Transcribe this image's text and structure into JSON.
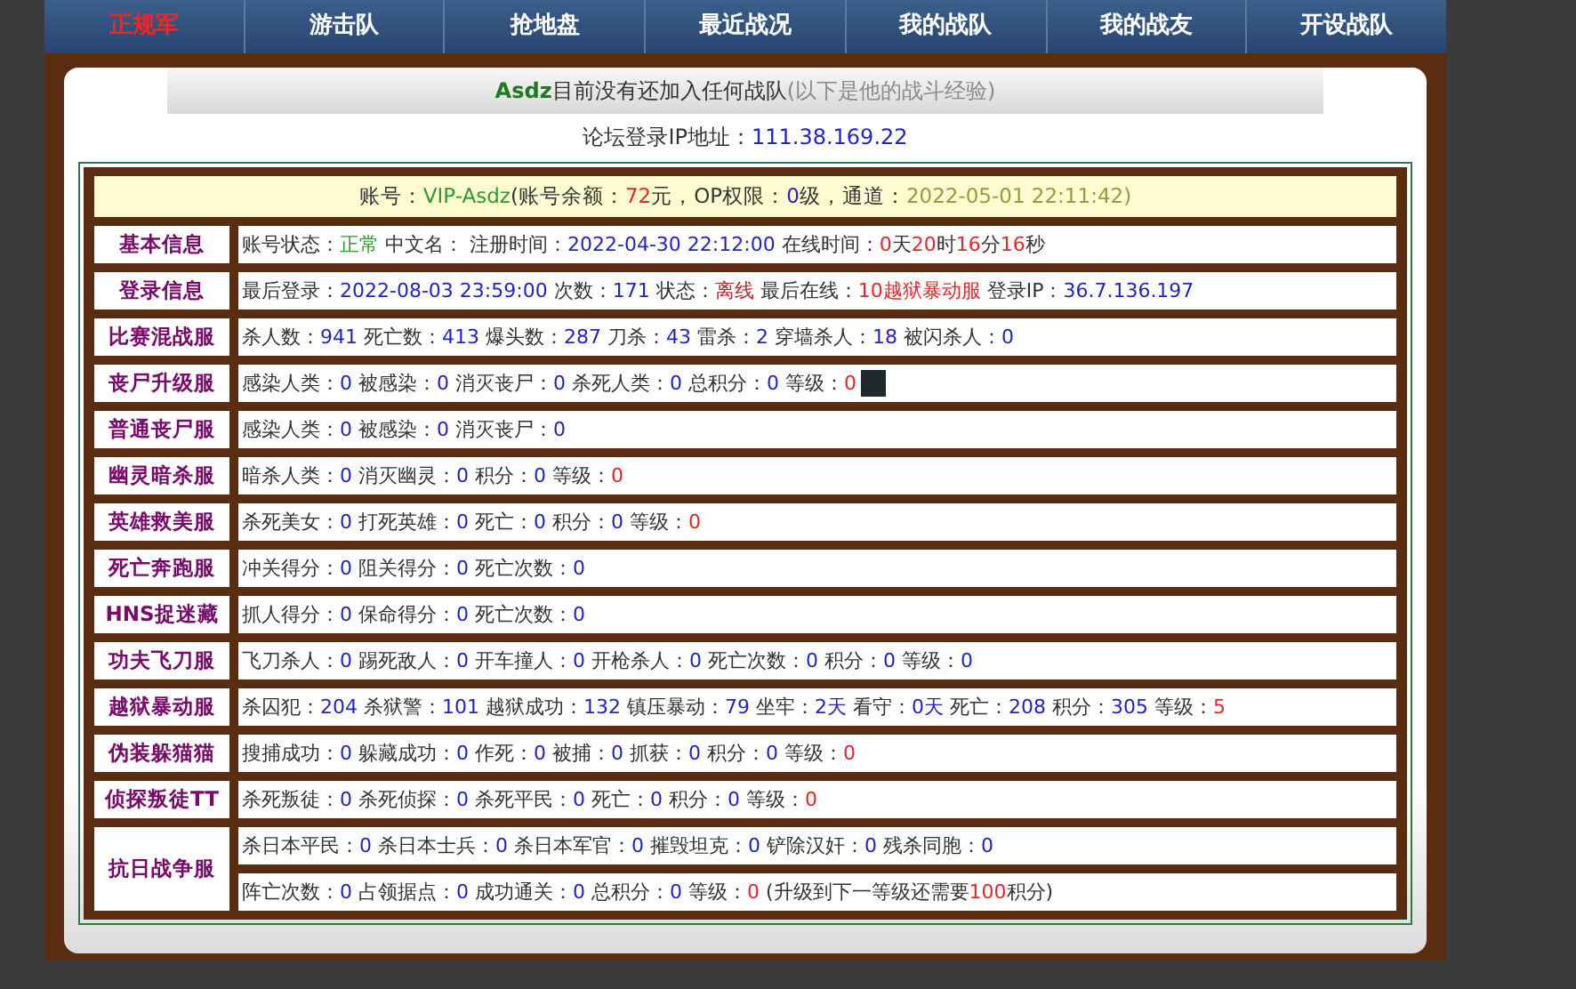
{
  "nav": [
    {
      "label": "正规军",
      "selected": true
    },
    {
      "label": "游击队",
      "selected": false
    },
    {
      "label": "抢地盘",
      "selected": false
    },
    {
      "label": "最近战况",
      "selected": false
    },
    {
      "label": "我的战队",
      "selected": false
    },
    {
      "label": "我的战友",
      "selected": false
    },
    {
      "label": "开设战队",
      "selected": false
    }
  ],
  "heading": [
    {
      "text": "Asdz",
      "kind": "name"
    },
    {
      "text": "目前没有还加入任何战队",
      "kind": "label"
    },
    {
      "text": "(以下是他的战斗经验)",
      "kind": "note"
    }
  ],
  "ip_line": [
    {
      "text": "论坛登录IP地址：",
      "kind": "label"
    },
    {
      "text": "111.38.169.22",
      "kind": "value"
    }
  ],
  "account_line": [
    {
      "text": "账号：",
      "kind": "label"
    },
    {
      "text": "VIP-Asdz",
      "kind": "ok"
    },
    {
      "text": "(账号余额：",
      "kind": "label"
    },
    {
      "text": "72",
      "kind": "alert"
    },
    {
      "text": "元，OP权限：",
      "kind": "label"
    },
    {
      "text": "0",
      "kind": "value"
    },
    {
      "text": "级，通道：",
      "kind": "label"
    },
    {
      "text": "2022-05-01 22:11:42",
      "kind": "date"
    },
    {
      "text": ")",
      "kind": "date"
    }
  ],
  "rows": [
    {
      "category": "基本信息",
      "lines": [
        [
          {
            "text": "账号状态：",
            "kind": "label"
          },
          {
            "text": "正常",
            "kind": "ok"
          },
          {
            "text": " 中文名： 注册时间：",
            "kind": "label"
          },
          {
            "text": "2022-04-30 22:12:00",
            "kind": "value"
          },
          {
            "text": " 在线时间：",
            "kind": "label"
          },
          {
            "text": "0",
            "kind": "alert"
          },
          {
            "text": "天",
            "kind": "label"
          },
          {
            "text": "20",
            "kind": "alert"
          },
          {
            "text": "时",
            "kind": "label"
          },
          {
            "text": "16",
            "kind": "alert"
          },
          {
            "text": "分",
            "kind": "label"
          },
          {
            "text": "16",
            "kind": "alert"
          },
          {
            "text": "秒",
            "kind": "label"
          }
        ]
      ]
    },
    {
      "category": "登录信息",
      "lines": [
        [
          {
            "text": "最后登录：",
            "kind": "label"
          },
          {
            "text": "2022-08-03 23:59:00",
            "kind": "value"
          },
          {
            "text": " 次数：",
            "kind": "label"
          },
          {
            "text": "171",
            "kind": "value"
          },
          {
            "text": " 状态：",
            "kind": "label"
          },
          {
            "text": "离线",
            "kind": "offline"
          },
          {
            "text": " 最后在线：",
            "kind": "label"
          },
          {
            "text": "10越狱暴动服",
            "kind": "alert"
          },
          {
            "text": " 登录IP：",
            "kind": "label"
          },
          {
            "text": "36.7.136.197",
            "kind": "value"
          }
        ]
      ]
    },
    {
      "category": "比赛混战服",
      "lines": [
        [
          {
            "text": "杀人数：",
            "kind": "label"
          },
          {
            "text": "941",
            "kind": "value"
          },
          {
            "text": " 死亡数：",
            "kind": "label"
          },
          {
            "text": "413",
            "kind": "value"
          },
          {
            "text": " 爆头数：",
            "kind": "label"
          },
          {
            "text": "287",
            "kind": "value"
          },
          {
            "text": " 刀杀：",
            "kind": "label"
          },
          {
            "text": "43",
            "kind": "value"
          },
          {
            "text": " 雷杀：",
            "kind": "label"
          },
          {
            "text": "2",
            "kind": "value"
          },
          {
            "text": " 穿墙杀人：",
            "kind": "label"
          },
          {
            "text": "18",
            "kind": "value"
          },
          {
            "text": " 被闪杀人：",
            "kind": "label"
          },
          {
            "text": "0",
            "kind": "value"
          }
        ]
      ]
    },
    {
      "category": "丧尸升级服",
      "lines": [
        [
          {
            "text": "感染人类：",
            "kind": "label"
          },
          {
            "text": "0",
            "kind": "value"
          },
          {
            "text": " 被感染：",
            "kind": "label"
          },
          {
            "text": "0",
            "kind": "value"
          },
          {
            "text": " 消灭丧尸：",
            "kind": "label"
          },
          {
            "text": "0",
            "kind": "value"
          },
          {
            "text": " 杀死人类：",
            "kind": "label"
          },
          {
            "text": "0",
            "kind": "value"
          },
          {
            "text": " 总积分：",
            "kind": "label"
          },
          {
            "text": "0",
            "kind": "value"
          },
          {
            "text": " 等级：",
            "kind": "label"
          },
          {
            "text": "0",
            "kind": "alert"
          },
          {
            "kind": "image"
          }
        ]
      ]
    },
    {
      "category": "普通丧尸服",
      "lines": [
        [
          {
            "text": "感染人类：",
            "kind": "label"
          },
          {
            "text": "0",
            "kind": "value"
          },
          {
            "text": " 被感染：",
            "kind": "label"
          },
          {
            "text": "0",
            "kind": "value"
          },
          {
            "text": " 消灭丧尸：",
            "kind": "label"
          },
          {
            "text": "0",
            "kind": "value"
          }
        ]
      ]
    },
    {
      "category": "幽灵暗杀服",
      "lines": [
        [
          {
            "text": "暗杀人类：",
            "kind": "label"
          },
          {
            "text": "0",
            "kind": "value"
          },
          {
            "text": " 消灭幽灵：",
            "kind": "label"
          },
          {
            "text": "0",
            "kind": "value"
          },
          {
            "text": " 积分：",
            "kind": "label"
          },
          {
            "text": "0",
            "kind": "value"
          },
          {
            "text": " 等级：",
            "kind": "label"
          },
          {
            "text": "0",
            "kind": "alert"
          }
        ]
      ]
    },
    {
      "category": "英雄救美服",
      "lines": [
        [
          {
            "text": "杀死美女：",
            "kind": "label"
          },
          {
            "text": "0",
            "kind": "value"
          },
          {
            "text": " 打死英雄：",
            "kind": "label"
          },
          {
            "text": "0",
            "kind": "value"
          },
          {
            "text": " 死亡：",
            "kind": "label"
          },
          {
            "text": "0",
            "kind": "value"
          },
          {
            "text": " 积分：",
            "kind": "label"
          },
          {
            "text": "0",
            "kind": "value"
          },
          {
            "text": " 等级：",
            "kind": "label"
          },
          {
            "text": "0",
            "kind": "alert"
          }
        ]
      ]
    },
    {
      "category": "死亡奔跑服",
      "lines": [
        [
          {
            "text": "冲关得分：",
            "kind": "label"
          },
          {
            "text": "0",
            "kind": "value"
          },
          {
            "text": " 阻关得分：",
            "kind": "label"
          },
          {
            "text": "0",
            "kind": "value"
          },
          {
            "text": " 死亡次数：",
            "kind": "label"
          },
          {
            "text": "0",
            "kind": "value"
          }
        ]
      ]
    },
    {
      "category": "HNS捉迷藏",
      "lines": [
        [
          {
            "text": "抓人得分：",
            "kind": "label"
          },
          {
            "text": "0",
            "kind": "value"
          },
          {
            "text": " 保命得分：",
            "kind": "label"
          },
          {
            "text": "0",
            "kind": "value"
          },
          {
            "text": " 死亡次数：",
            "kind": "label"
          },
          {
            "text": "0",
            "kind": "value"
          }
        ]
      ]
    },
    {
      "category": "功夫飞刀服",
      "lines": [
        [
          {
            "text": "飞刀杀人：",
            "kind": "label"
          },
          {
            "text": "0",
            "kind": "value"
          },
          {
            "text": " 踢死敌人：",
            "kind": "label"
          },
          {
            "text": "0",
            "kind": "value"
          },
          {
            "text": " 开车撞人：",
            "kind": "label"
          },
          {
            "text": "0",
            "kind": "value"
          },
          {
            "text": " 开枪杀人：",
            "kind": "label"
          },
          {
            "text": "0",
            "kind": "value"
          },
          {
            "text": " 死亡次数：",
            "kind": "label"
          },
          {
            "text": "0",
            "kind": "value"
          },
          {
            "text": " 积分：",
            "kind": "label"
          },
          {
            "text": "0",
            "kind": "value"
          },
          {
            "text": " 等级：",
            "kind": "label"
          },
          {
            "text": "0",
            "kind": "value"
          }
        ]
      ]
    },
    {
      "category": "越狱暴动服",
      "lines": [
        [
          {
            "text": "杀囚犯：",
            "kind": "label"
          },
          {
            "text": "204",
            "kind": "value"
          },
          {
            "text": " 杀狱警：",
            "kind": "label"
          },
          {
            "text": "101",
            "kind": "value"
          },
          {
            "text": " 越狱成功：",
            "kind": "label"
          },
          {
            "text": "132",
            "kind": "value"
          },
          {
            "text": " 镇压暴动：",
            "kind": "label"
          },
          {
            "text": "79",
            "kind": "value"
          },
          {
            "text": " 坐牢：",
            "kind": "label"
          },
          {
            "text": "2天",
            "kind": "value"
          },
          {
            "text": " 看守：",
            "kind": "label"
          },
          {
            "text": "0天",
            "kind": "value"
          },
          {
            "text": " 死亡：",
            "kind": "label"
          },
          {
            "text": "208",
            "kind": "value"
          },
          {
            "text": " 积分：",
            "kind": "label"
          },
          {
            "text": "305",
            "kind": "value"
          },
          {
            "text": " 等级：",
            "kind": "label"
          },
          {
            "text": "5",
            "kind": "alert"
          }
        ]
      ]
    },
    {
      "category": "伪装躲猫猫",
      "lines": [
        [
          {
            "text": "搜捕成功：",
            "kind": "label"
          },
          {
            "text": "0",
            "kind": "value"
          },
          {
            "text": " 躲藏成功：",
            "kind": "label"
          },
          {
            "text": "0",
            "kind": "value"
          },
          {
            "text": " 作死：",
            "kind": "label"
          },
          {
            "text": "0",
            "kind": "value"
          },
          {
            "text": " 被捕：",
            "kind": "label"
          },
          {
            "text": "0",
            "kind": "value"
          },
          {
            "text": " 抓获：",
            "kind": "label"
          },
          {
            "text": "0",
            "kind": "value"
          },
          {
            "text": " 积分：",
            "kind": "label"
          },
          {
            "text": "0",
            "kind": "value"
          },
          {
            "text": " 等级：",
            "kind": "label"
          },
          {
            "text": "0",
            "kind": "alert"
          }
        ]
      ]
    },
    {
      "category": "侦探叛徒TT",
      "lines": [
        [
          {
            "text": "杀死叛徒：",
            "kind": "label"
          },
          {
            "text": "0",
            "kind": "value"
          },
          {
            "text": " 杀死侦探：",
            "kind": "label"
          },
          {
            "text": "0",
            "kind": "value"
          },
          {
            "text": " 杀死平民：",
            "kind": "label"
          },
          {
            "text": "0",
            "kind": "value"
          },
          {
            "text": " 死亡：",
            "kind": "label"
          },
          {
            "text": "0",
            "kind": "value"
          },
          {
            "text": " 积分：",
            "kind": "label"
          },
          {
            "text": "0",
            "kind": "value"
          },
          {
            "text": " 等级：",
            "kind": "label"
          },
          {
            "text": "0",
            "kind": "alert"
          }
        ]
      ]
    },
    {
      "category": "抗日战争服",
      "lines": [
        [
          {
            "text": "杀日本平民：",
            "kind": "label"
          },
          {
            "text": "0",
            "kind": "value"
          },
          {
            "text": " 杀日本士兵：",
            "kind": "label"
          },
          {
            "text": "0",
            "kind": "value"
          },
          {
            "text": " 杀日本军官：",
            "kind": "label"
          },
          {
            "text": "0",
            "kind": "value"
          },
          {
            "text": " 摧毁坦克：",
            "kind": "label"
          },
          {
            "text": "0",
            "kind": "value"
          },
          {
            "text": " 铲除汉奸：",
            "kind": "label"
          },
          {
            "text": "0",
            "kind": "value"
          },
          {
            "text": " 残杀同胞：",
            "kind": "label"
          },
          {
            "text": "0",
            "kind": "value"
          }
        ],
        [
          {
            "text": "阵亡次数：",
            "kind": "label"
          },
          {
            "text": "0",
            "kind": "value"
          },
          {
            "text": " 占领据点：",
            "kind": "label"
          },
          {
            "text": "0",
            "kind": "value"
          },
          {
            "text": " 成功通关：",
            "kind": "label"
          },
          {
            "text": "0",
            "kind": "value"
          },
          {
            "text": " 总积分：",
            "kind": "label"
          },
          {
            "text": "0",
            "kind": "value"
          },
          {
            "text": " 等级：",
            "kind": "label"
          },
          {
            "text": "0",
            "kind": "alert"
          },
          {
            "text": " (升级到下一等级还需要",
            "kind": "label"
          },
          {
            "text": "100",
            "kind": "alert"
          },
          {
            "text": "积分)",
            "kind": "label"
          }
        ]
      ]
    }
  ]
}
